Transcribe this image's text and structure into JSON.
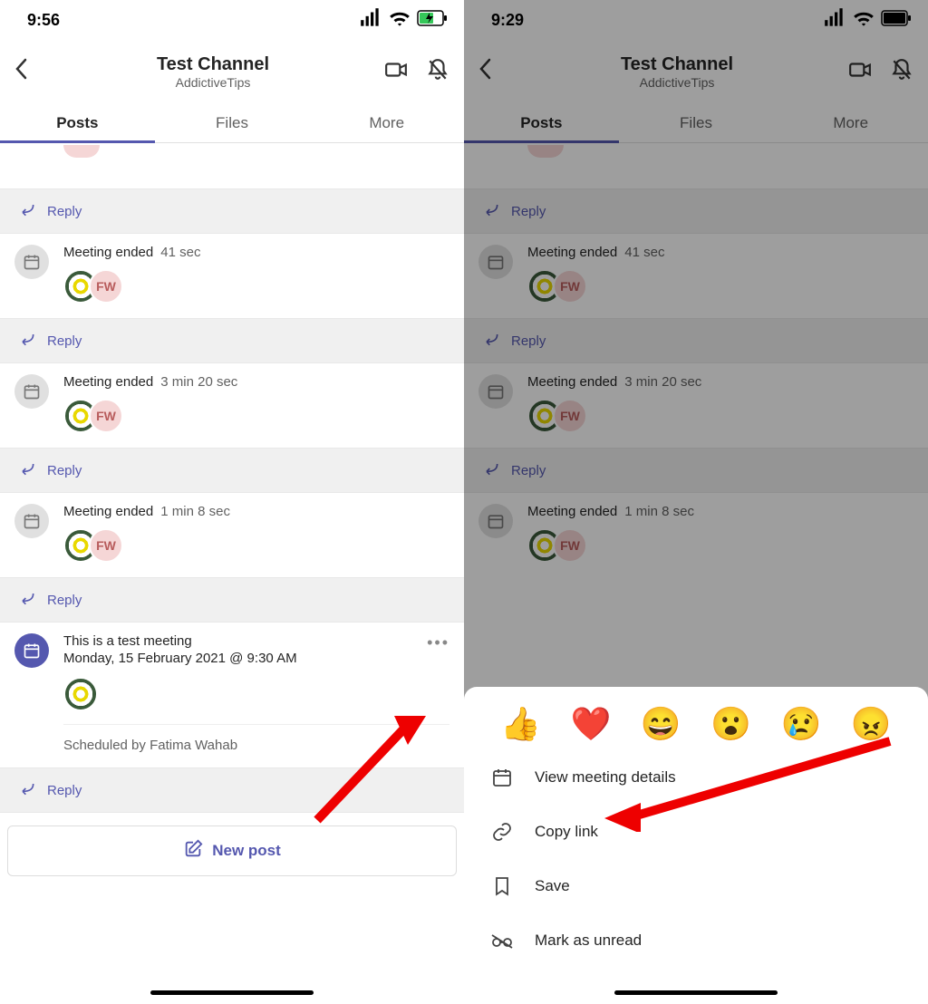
{
  "left": {
    "time": "9:56",
    "battery_charging": true
  },
  "right": {
    "time": "9:29",
    "battery_charging": false
  },
  "header": {
    "title": "Test Channel",
    "subtitle": "AddictiveTips"
  },
  "tabs": {
    "posts": "Posts",
    "files": "Files",
    "more": "More"
  },
  "reply_label": "Reply",
  "posts": [
    {
      "text": "Meeting ended",
      "duration": "41 sec",
      "fw": "FW"
    },
    {
      "text": "Meeting ended",
      "duration": "3 min 20 sec",
      "fw": "FW"
    },
    {
      "text": "Meeting ended",
      "duration": "1 min 8 sec",
      "fw": "FW"
    }
  ],
  "meeting": {
    "title": "This is a test meeting",
    "date": "Monday, 15 February 2021 @ 9:30 AM",
    "scheduled_by": "Scheduled by Fatima Wahab"
  },
  "new_post": "New post",
  "sheet": {
    "reactions": [
      "👍",
      "❤️",
      "😄",
      "😮",
      "😢",
      "😠"
    ],
    "view_details": "View meeting details",
    "copy_link": "Copy link",
    "save": "Save",
    "mark_unread": "Mark as unread"
  }
}
